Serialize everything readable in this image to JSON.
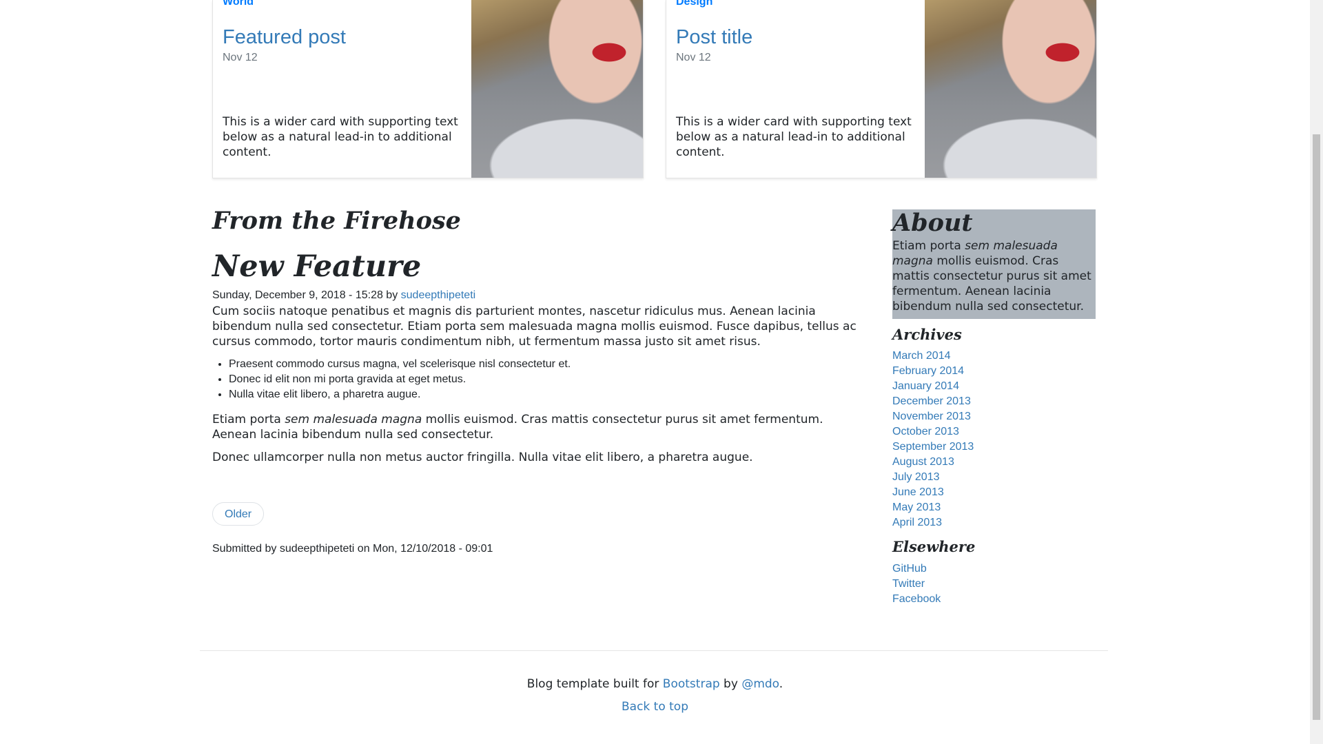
{
  "cards": [
    {
      "category": "World",
      "title": "Featured post",
      "date": "Nov 12",
      "text": "This is a wider card with supporting text below as a natural lead-in to additional content."
    },
    {
      "category": "Design",
      "title": "Post title",
      "date": "Nov 12",
      "text": "This is a wider card with supporting text below as a natural lead-in to additional content."
    }
  ],
  "main": {
    "section_title": "From the Firehose",
    "post": {
      "title": "New Feature",
      "meta_date": "Sunday, December 9, 2018 - 15:28 by ",
      "author": "sudeepthipeteti",
      "paragraph1": "Cum sociis natoque penatibus et magnis dis parturient montes, nascetur ridiculus mus. Aenean lacinia bibendum nulla sed consectetur. Etiam porta sem malesuada magna mollis euismod. Fusce dapibus, tellus ac cursus commodo, tortor mauris condimentum nibh, ut fermentum massa justo sit amet risus.",
      "list": [
        "Praesent commodo cursus magna, vel scelerisque nisl consectetur et.",
        "Donec id elit non mi porta gravida at eget metus.",
        "Nulla vitae elit libero, a pharetra augue."
      ],
      "p2_start": "Etiam porta ",
      "p2_em": "sem malesuada magna",
      "p2_end": " mollis euismod. Cras mattis consectetur purus sit amet fermentum. Aenean lacinia bibendum nulla sed consectetur.",
      "paragraph3": "Donec ullamcorper nulla non metus auctor fringilla. Nulla vitae elit libero, a pharetra augue."
    },
    "older_label": "Older",
    "submitted": "Submitted by sudeepthipeteti on Mon, 12/10/2018 - 09:01"
  },
  "sidebar": {
    "about_title": "About",
    "about_start": "Etiam porta ",
    "about_em": "sem malesuada magna",
    "about_end": " mollis euismod. Cras mattis consectetur purus sit amet fermentum. Aenean lacinia bibendum nulla sed consectetur.",
    "archives_title": "Archives",
    "archives": [
      "March 2014",
      "February 2014",
      "January 2014",
      "December 2013",
      "November 2013",
      "October 2013",
      "September 2013",
      "August 2013",
      "July 2013",
      "June 2013",
      "May 2013",
      "April 2013"
    ],
    "elsewhere_title": "Elsewhere",
    "elsewhere": [
      "GitHub",
      "Twitter",
      "Facebook"
    ]
  },
  "footer": {
    "text_before": "Blog template built for ",
    "bootstrap": "Bootstrap",
    "text_by": " by ",
    "mdo": "@mdo",
    "text_end": ".",
    "back_to_top": "Back to top"
  },
  "colors": {
    "link": "#337ab7",
    "category": "#007bff",
    "about_bg": "#adb5bd"
  }
}
